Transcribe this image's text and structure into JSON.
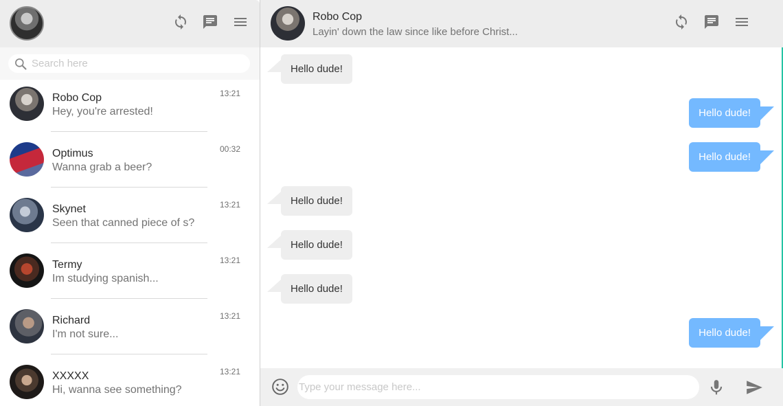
{
  "me": {
    "avatar_icon": "user-avatar"
  },
  "sidebar_header": {
    "icons": [
      "refresh-icon",
      "new-chat-icon",
      "menu-icon"
    ]
  },
  "search": {
    "placeholder": "Search here"
  },
  "contacts": [
    {
      "name": "Robo Cop",
      "message": "Hey, you're arrested!",
      "time": "13:21"
    },
    {
      "name": "Optimus",
      "message": "Wanna grab a beer?",
      "time": "00:32"
    },
    {
      "name": "Skynet",
      "message": "Seen that canned piece of s?",
      "time": "13:21"
    },
    {
      "name": "Termy",
      "message": "Im studying spanish...",
      "time": "13:21"
    },
    {
      "name": "Richard",
      "message": "I'm not sure...",
      "time": "13:21"
    },
    {
      "name": "XXXXX",
      "message": "Hi, wanna see something?",
      "time": "13:21"
    }
  ],
  "chat_header": {
    "name": "Robo Cop",
    "status": "Layin' down the law since like before Christ..."
  },
  "messages": [
    {
      "direction": "in",
      "text": "Hello dude!"
    },
    {
      "direction": "out",
      "text": "Hello dude!"
    },
    {
      "direction": "out",
      "text": "Hello dude!"
    },
    {
      "direction": "in",
      "text": "Hello dude!"
    },
    {
      "direction": "in",
      "text": "Hello dude!"
    },
    {
      "direction": "in",
      "text": "Hello dude!"
    },
    {
      "direction": "out",
      "text": "Hello dude!"
    }
  ],
  "composer": {
    "placeholder": "Type your message here..."
  },
  "colors": {
    "outgoing": "#74b9ff",
    "incoming": "#eeeeee",
    "header": "#ededed",
    "accent": "#25c4a4"
  }
}
